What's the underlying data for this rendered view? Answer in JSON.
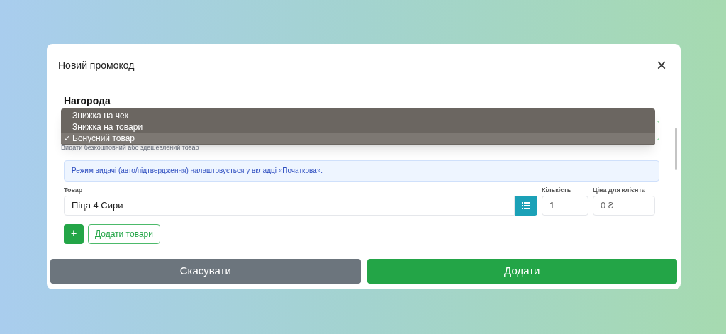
{
  "dialog": {
    "title": "Новий промокод",
    "close": "×"
  },
  "reward": {
    "heading": "Нагорода",
    "options": [
      {
        "label": "Знижка на чек",
        "selected": false
      },
      {
        "label": "Знижка на товари",
        "selected": false
      },
      {
        "label": "Бонусний товар",
        "selected": true
      }
    ],
    "check": "✓",
    "hint": "Видати безкоштовний або здешевлений товар"
  },
  "info": "Режим видачі (авто/підтвердження) налаштовується у вкладці «Початкова».",
  "product": {
    "label": "Товар",
    "value": "Піца 4 Сири"
  },
  "quantity": {
    "label": "Кількість",
    "value": "1"
  },
  "price": {
    "label": "Ціна для клієнта",
    "placeholder": "0 ₴"
  },
  "add_icon": "+",
  "add_products": "Додати товари",
  "buttons": [
    {
      "label": "Скасувати",
      "kind": "cancel"
    },
    {
      "label": "Додати",
      "kind": "primary"
    }
  ]
}
